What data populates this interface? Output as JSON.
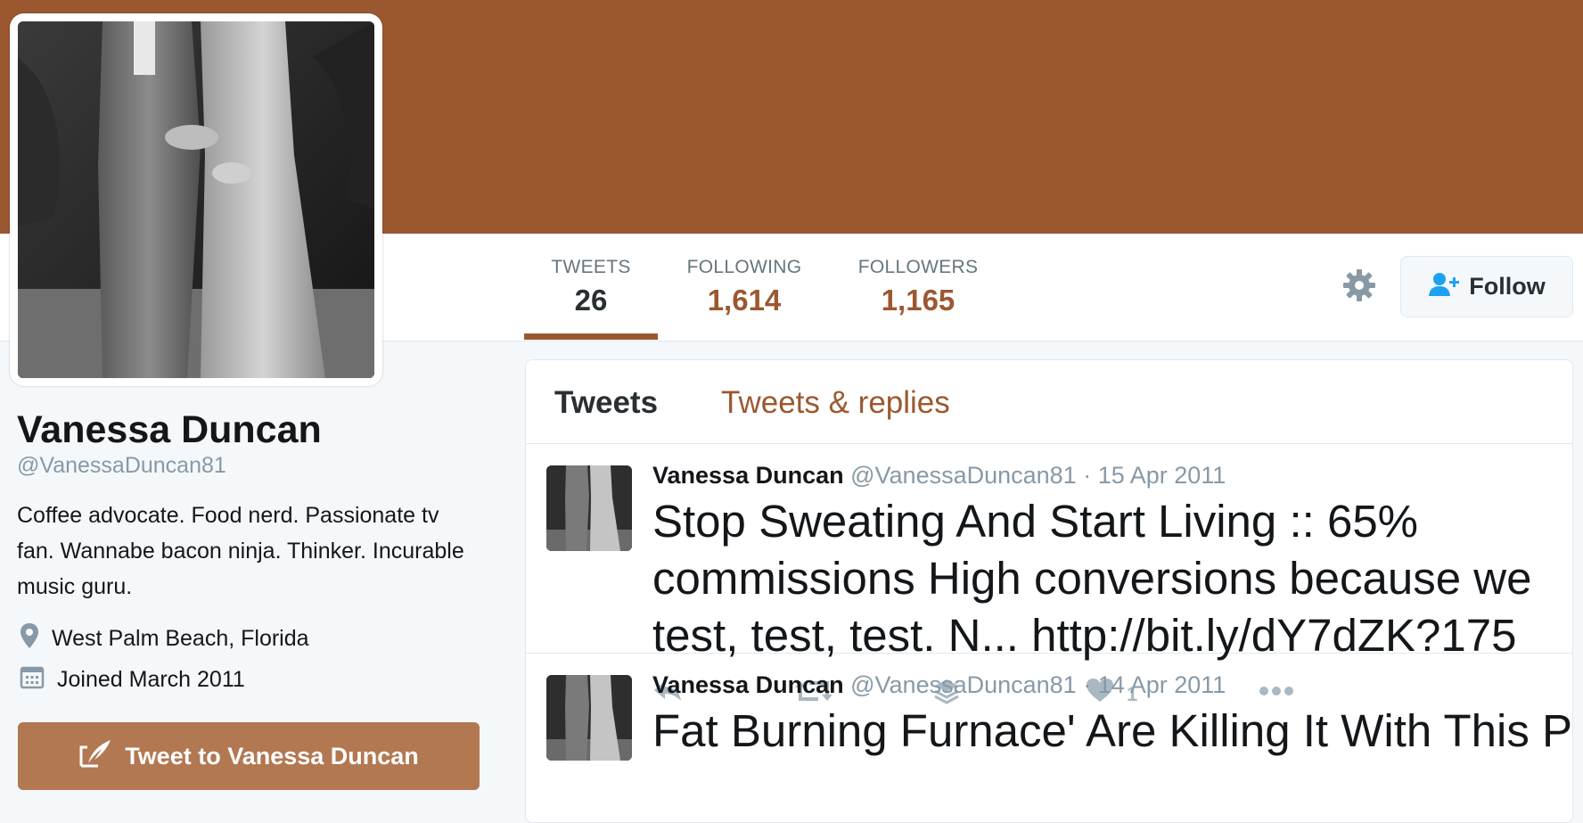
{
  "profile": {
    "name": "Vanessa Duncan",
    "handle": "@VanessaDuncan81",
    "bio": "Coffee advocate. Food nerd. Passionate tv fan. Wannabe bacon ninja. Thinker. Incurable music guru.",
    "location": "West Palm Beach, Florida",
    "joined": "Joined March 2011",
    "tweet_to_label": "Tweet to Vanessa Duncan"
  },
  "stats": {
    "tweets_label": "TWEETS",
    "tweets_value": "26",
    "following_label": "FOLLOWING",
    "following_value": "1,614",
    "followers_label": "FOLLOWERS",
    "followers_value": "1,165"
  },
  "actions": {
    "follow_label": "Follow"
  },
  "tabs": {
    "tweets": "Tweets",
    "replies": "Tweets & replies"
  },
  "tweets": [
    {
      "name": "Vanessa Duncan",
      "meta": "@VanessaDuncan81 · 15 Apr 2011",
      "text": "Stop Sweating And Start Living :: 65% commissions High conversions because we test, test, test. N... http://bit.ly/dY7dZK?175",
      "like_count": "1"
    },
    {
      "name": "Vanessa Duncan",
      "meta": "@VanessaDuncan81 · 14 Apr 2011",
      "text": "Fat Burning Furnace' Are Killing It With This Product People Love - it"
    }
  ],
  "colors": {
    "brand": "#9b5830",
    "tweet_to_button": "#b27852",
    "muted_text": "#8899a6"
  },
  "icons": [
    "gear-icon",
    "add-user-icon",
    "location-pin-icon",
    "calendar-icon",
    "quill-icon",
    "reply-icon",
    "retweet-icon",
    "layers-icon",
    "heart-icon",
    "more-icon"
  ]
}
